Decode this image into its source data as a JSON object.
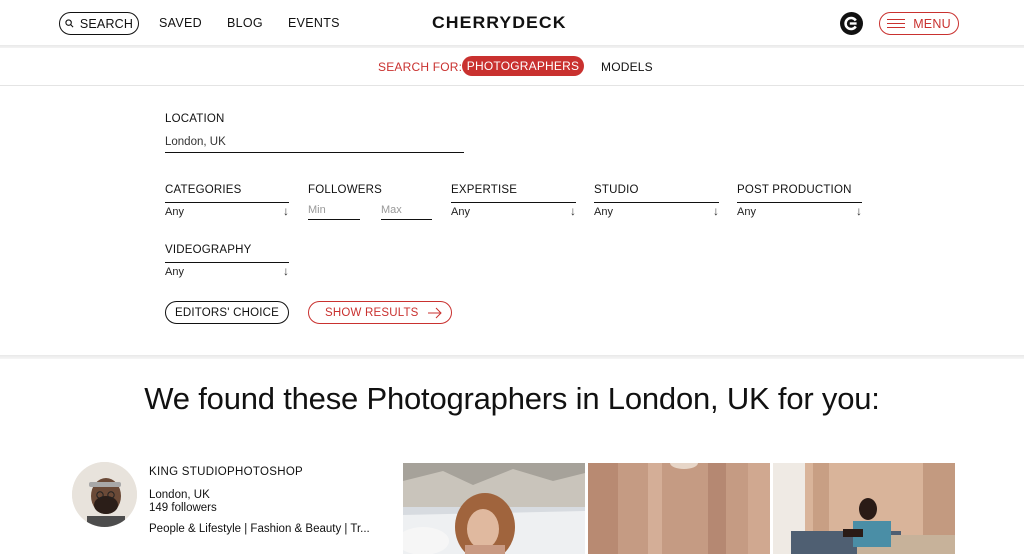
{
  "header": {
    "search_label": "SEARCH",
    "nav": [
      "SAVED",
      "BLOG",
      "EVENTS"
    ],
    "logo": "CHERRYDECK",
    "menu_label": "MENU",
    "accent_color": "#c9312f"
  },
  "search_for": {
    "label": "SEARCH FOR:",
    "options": [
      "PHOTOGRAPHERS",
      "MODELS"
    ],
    "selected": "PHOTOGRAPHERS"
  },
  "filters": {
    "location": {
      "label": "LOCATION",
      "value": "London, UK"
    },
    "categories": {
      "label": "CATEGORIES",
      "value": "Any"
    },
    "followers": {
      "label": "FOLLOWERS",
      "min_placeholder": "Min",
      "max_placeholder": "Max"
    },
    "expertise": {
      "label": "EXPERTISE",
      "value": "Any"
    },
    "studio": {
      "label": "STUDIO",
      "value": "Any"
    },
    "post_production": {
      "label": "POST PRODUCTION",
      "value": "Any"
    },
    "videography": {
      "label": "VIDEOGRAPHY",
      "value": "Any"
    },
    "editors_choice_label": "EDITORS' CHOICE",
    "show_results_label": "SHOW RESULTS"
  },
  "results": {
    "heading": "We found these Photographers in London, UK for you:",
    "items": [
      {
        "name": "KING STUDIOPHOTOSHOP",
        "location": "London, UK",
        "followers": "149 followers",
        "categories": "People & Lifestyle | Fashion & Beauty | Tr..."
      }
    ]
  },
  "icons": {
    "search": "search-icon",
    "logo_mark": "cherrydeck-c-icon",
    "menu": "hamburger-icon",
    "arrow_down": "arrow-down-icon",
    "arrow_right": "arrow-right-icon"
  }
}
